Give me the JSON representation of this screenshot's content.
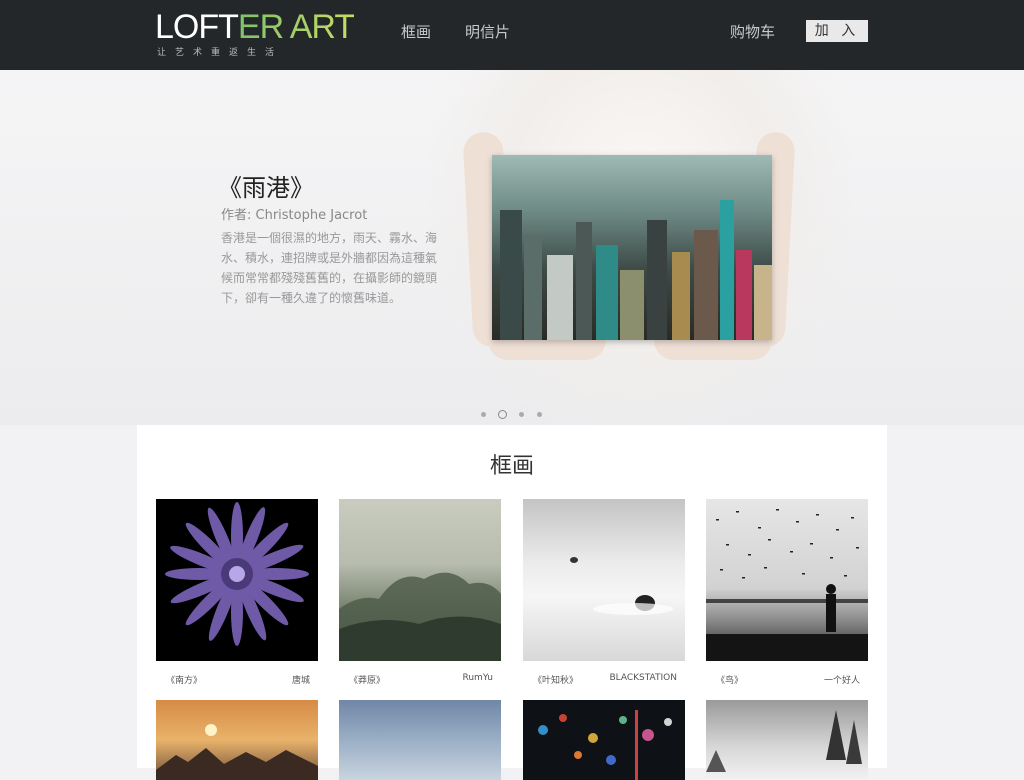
{
  "header": {
    "logo_main_left": "LOFT",
    "logo_main_right": "ER ART",
    "logo_sub": "让艺术重返生活",
    "nav": [
      {
        "label": "框画"
      },
      {
        "label": "明信片"
      }
    ],
    "cart_label": "购物车",
    "join_label": "加 入"
  },
  "hero": {
    "title": "《雨港》",
    "author": "作者: Christophe Jacrot",
    "description": "香港是一個很濕的地方，雨天、霧水、海水、積水，連招牌或是外牆都因為這種氣候而常常都殘殘舊舊的，在攝影師的鏡頭下，卻有一種久違了的懷舊味道。",
    "slides": 4,
    "active_slide": 2
  },
  "section": {
    "title": "框画",
    "items": [
      {
        "title": "《南方》",
        "author": "唐城",
        "icon": "flower-photo"
      },
      {
        "title": "《莽原》",
        "author": "RumYu",
        "icon": "misty-forest-photo"
      },
      {
        "title": "《叶知秋》",
        "author": "BLACKSTATION",
        "icon": "minimal-sea-photo"
      },
      {
        "title": "《鸟》",
        "author": "一个好人",
        "icon": "birds-beach-photo"
      }
    ]
  },
  "colors": {
    "header_bg": "#24272a",
    "logo_accent": "#9ccc65",
    "panel_bg": "#ffffff"
  }
}
